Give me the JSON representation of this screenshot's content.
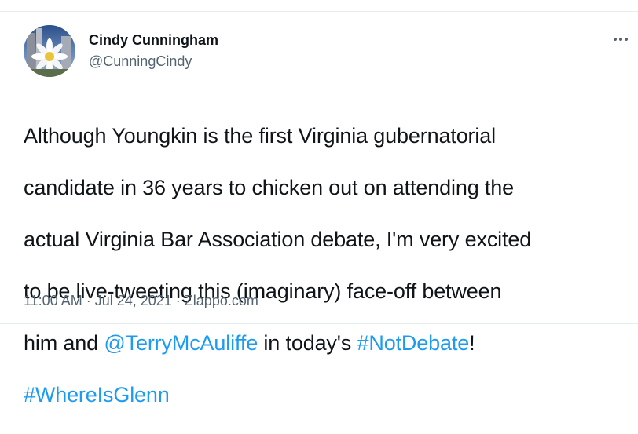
{
  "author": {
    "name": "Cindy Cunningham",
    "handle": "@CunningCindy",
    "avatar_icon": "daisy-flower-avatar"
  },
  "tweet": {
    "line1": "Although Youngkin is the first Virginia gubernatorial",
    "line2": "candidate in 36 years to chicken out on attending the",
    "line3": "actual Virginia Bar Association debate, I'm very excited",
    "line4": "to be live-tweeting this (imaginary) face-off between",
    "line5_a": "him and ",
    "mention": "@TerryMcAuliffe",
    "line5_b": " in today's ",
    "hashtag1": "#NotDebate",
    "line5_c": "!",
    "hashtag2": "#WhereIsGlenn"
  },
  "meta": {
    "time": "11:00 AM",
    "sep1": " · ",
    "date": "Jul 24, 2021",
    "sep2": " · ",
    "source": "Zlappo.com"
  },
  "colors": {
    "link": "#1d9bf0",
    "secondary_text": "#536471",
    "primary_text": "#0f1419"
  }
}
